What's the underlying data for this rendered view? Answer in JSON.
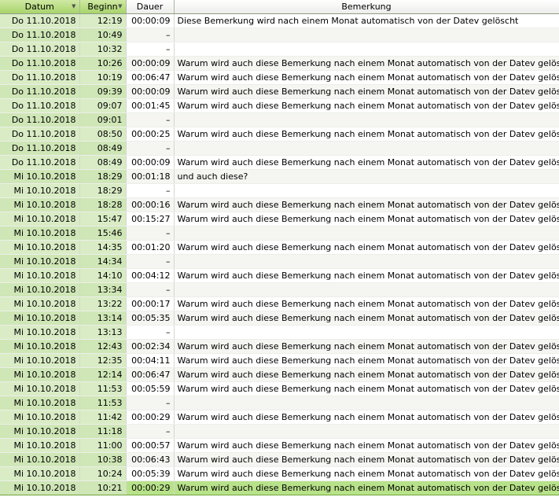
{
  "columns": [
    {
      "label": "Datum",
      "arrow": "▼",
      "sorted": true
    },
    {
      "label": "Beginn",
      "arrow": "▼",
      "sorted": true
    },
    {
      "label": "Dauer",
      "arrow": "",
      "sorted": false
    },
    {
      "label": "Bemerkung",
      "arrow": "",
      "sorted": false
    }
  ],
  "rows": [
    {
      "date": "Do 11.10.2018",
      "start": "12:19",
      "duration": "00:00:09",
      "note": "Diese Bemerkung wird nach einem Monat automatisch von der Datev gelöscht"
    },
    {
      "date": "Do 11.10.2018",
      "start": "10:49",
      "duration": "–",
      "note": ""
    },
    {
      "date": "Do 11.10.2018",
      "start": "10:32",
      "duration": "–",
      "note": ""
    },
    {
      "date": "Do 11.10.2018",
      "start": "10:26",
      "duration": "00:00:09",
      "note": "Warum wird auch diese Bemerkung nach einem Monat automatisch von der Datev gelöscht?"
    },
    {
      "date": "Do 11.10.2018",
      "start": "10:19",
      "duration": "00:06:47",
      "note": "Warum wird auch diese Bemerkung nach einem Monat automatisch von der Datev gelöscht?"
    },
    {
      "date": "Do 11.10.2018",
      "start": "09:39",
      "duration": "00:00:09",
      "note": "Warum wird auch diese Bemerkung nach einem Monat automatisch von der Datev gelöscht?"
    },
    {
      "date": "Do 11.10.2018",
      "start": "09:07",
      "duration": "00:01:45",
      "note": "Warum wird auch diese Bemerkung nach einem Monat automatisch von der Datev gelöscht?"
    },
    {
      "date": "Do 11.10.2018",
      "start": "09:01",
      "duration": "–",
      "note": ""
    },
    {
      "date": "Do 11.10.2018",
      "start": "08:50",
      "duration": "00:00:25",
      "note": "Warum wird auch diese Bemerkung nach einem Monat automatisch von der Datev gelöscht?"
    },
    {
      "date": "Do 11.10.2018",
      "start": "08:49",
      "duration": "–",
      "note": ""
    },
    {
      "date": "Do 11.10.2018",
      "start": "08:49",
      "duration": "00:00:09",
      "note": "Warum wird auch diese Bemerkung nach einem Monat automatisch von der Datev gelöscht?"
    },
    {
      "date": "Mi 10.10.2018",
      "start": "18:29",
      "duration": "00:01:18",
      "note": "und auch diese?"
    },
    {
      "date": "Mi 10.10.2018",
      "start": "18:29",
      "duration": "–",
      "note": ""
    },
    {
      "date": "Mi 10.10.2018",
      "start": "18:28",
      "duration": "00:00:16",
      "note": "Warum wird auch diese Bemerkung nach einem Monat automatisch von der Datev gelöscht?"
    },
    {
      "date": "Mi 10.10.2018",
      "start": "15:47",
      "duration": "00:15:27",
      "note": "Warum wird auch diese Bemerkung nach einem Monat automatisch von der Datev gelöscht?"
    },
    {
      "date": "Mi 10.10.2018",
      "start": "15:46",
      "duration": "–",
      "note": ""
    },
    {
      "date": "Mi 10.10.2018",
      "start": "14:35",
      "duration": "00:01:20",
      "note": "Warum wird auch diese Bemerkung nach einem Monat automatisch von der Datev gelöscht?"
    },
    {
      "date": "Mi 10.10.2018",
      "start": "14:34",
      "duration": "–",
      "note": ""
    },
    {
      "date": "Mi 10.10.2018",
      "start": "14:10",
      "duration": "00:04:12",
      "note": "Warum wird auch diese Bemerkung nach einem Monat automatisch von der Datev gelöscht?"
    },
    {
      "date": "Mi 10.10.2018",
      "start": "13:34",
      "duration": "–",
      "note": ""
    },
    {
      "date": "Mi 10.10.2018",
      "start": "13:22",
      "duration": "00:00:17",
      "note": "Warum wird auch diese Bemerkung nach einem Monat automatisch von der Datev gelöscht?"
    },
    {
      "date": "Mi 10.10.2018",
      "start": "13:14",
      "duration": "00:05:35",
      "note": "Warum wird auch diese Bemerkung nach einem Monat automatisch von der Datev gelöscht?"
    },
    {
      "date": "Mi 10.10.2018",
      "start": "13:13",
      "duration": "–",
      "note": ""
    },
    {
      "date": "Mi 10.10.2018",
      "start": "12:43",
      "duration": "00:02:34",
      "note": "Warum wird auch diese Bemerkung nach einem Monat automatisch von der Datev gelöscht?"
    },
    {
      "date": "Mi 10.10.2018",
      "start": "12:35",
      "duration": "00:04:11",
      "note": "Warum wird auch diese Bemerkung nach einem Monat automatisch von der Datev gelöscht?"
    },
    {
      "date": "Mi 10.10.2018",
      "start": "12:14",
      "duration": "00:06:47",
      "note": "Warum wird auch diese Bemerkung nach einem Monat automatisch von der Datev gelöscht?"
    },
    {
      "date": "Mi 10.10.2018",
      "start": "11:53",
      "duration": "00:05:59",
      "note": "Warum wird auch diese Bemerkung nach einem Monat automatisch von der Datev gelöscht?"
    },
    {
      "date": "Mi 10.10.2018",
      "start": "11:53",
      "duration": "–",
      "note": ""
    },
    {
      "date": "Mi 10.10.2018",
      "start": "11:42",
      "duration": "00:00:29",
      "note": "Warum wird auch diese Bemerkung nach einem Monat automatisch von der Datev gelöscht?"
    },
    {
      "date": "Mi 10.10.2018",
      "start": "11:18",
      "duration": "–",
      "note": ""
    },
    {
      "date": "Mi 10.10.2018",
      "start": "11:00",
      "duration": "00:00:57",
      "note": "Warum wird auch diese Bemerkung nach einem Monat automatisch von der Datev gelöscht?"
    },
    {
      "date": "Mi 10.10.2018",
      "start": "10:38",
      "duration": "00:06:43",
      "note": "Warum wird auch diese Bemerkung nach einem Monat automatisch von der Datev gelöscht?"
    },
    {
      "date": "Mi 10.10.2018",
      "start": "10:24",
      "duration": "00:05:39",
      "note": "Warum wird auch diese Bemerkung nach einem Monat automatisch von der Datev gelöscht?"
    },
    {
      "date": "Mi 10.10.2018",
      "start": "10:21",
      "duration": "00:00:29",
      "note": "Warum wird auch diese Bemerkung nach einem Monat automatisch von der Datev gelöscht?"
    }
  ],
  "selected_index": 33
}
